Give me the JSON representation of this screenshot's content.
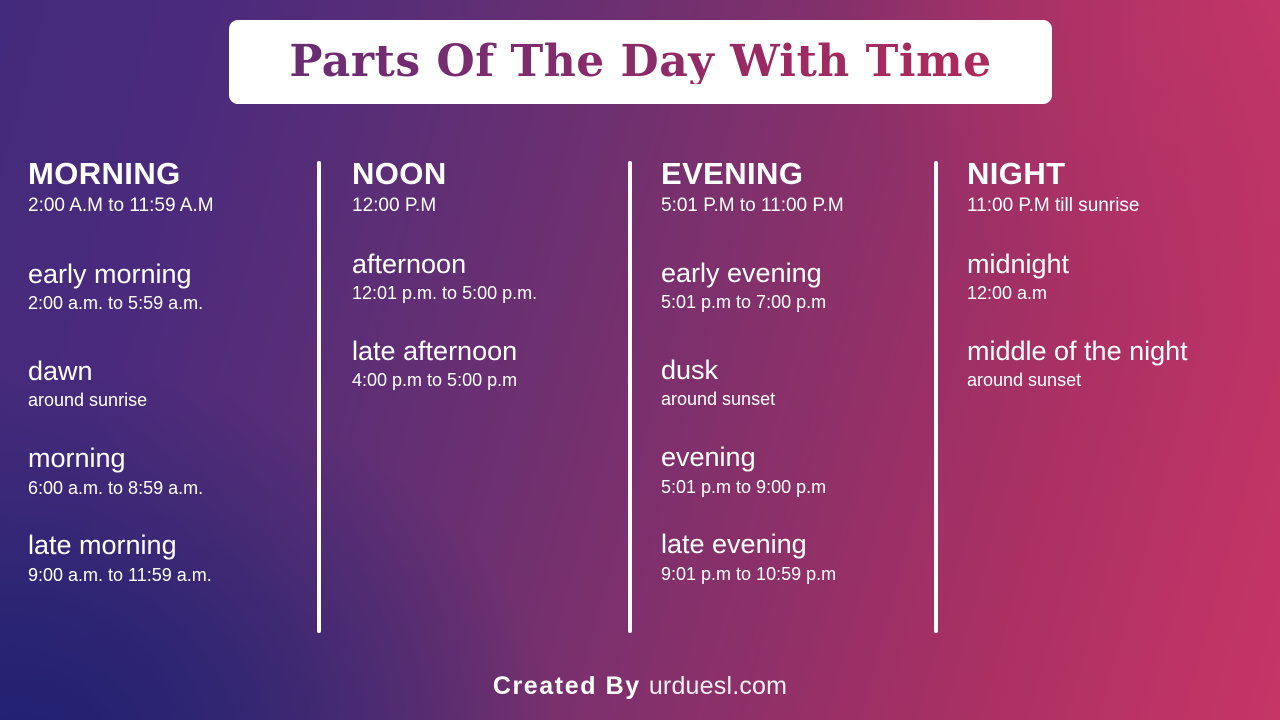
{
  "title": "Parts Of The Day With Time",
  "theme": {
    "bg_top_left": "#442a7c",
    "bg_top_right": "#c63566",
    "bg_bottom_left": "#252772",
    "bg_bottom_right": "#a93064",
    "bg_center": "#72306f",
    "title_gradient_start": "#6a2c74",
    "title_gradient_end": "#ae2a5d",
    "plate": "#ffffff",
    "text": "#ffffff",
    "divider": "#fdfdfe"
  },
  "columns": [
    {
      "heading": "MORNING",
      "heading_time": "2:00 A.M to 11:59 A.M",
      "entries": [
        {
          "name": "early morning",
          "time": "2:00 a.m. to 5:59 a.m."
        },
        {
          "name": "dawn",
          "time": "around sunrise"
        },
        {
          "name": "morning",
          "time": "6:00 a.m. to 8:59 a.m."
        },
        {
          "name": "late morning",
          "time": "9:00 a.m. to 11:59 a.m."
        }
      ]
    },
    {
      "heading": "NOON",
      "heading_time": "12:00 P.M",
      "entries": [
        {
          "name": "afternoon",
          "time": "12:01 p.m. to 5:00 p.m."
        },
        {
          "name": "late afternoon",
          "time": "4:00 p.m to 5:00 p.m"
        }
      ]
    },
    {
      "heading": "EVENING",
      "heading_time": "5:01 P.M to 11:00 P.M",
      "entries": [
        {
          "name": "early evening",
          "time": "5:01 p.m to 7:00 p.m"
        },
        {
          "name": "dusk",
          "time": "around sunset"
        },
        {
          "name": "evening",
          "time": "5:01 p.m to 9:00 p.m"
        },
        {
          "name": "late evening",
          "time": "9:01 p.m to 10:59 p.m"
        }
      ]
    },
    {
      "heading": "NIGHT",
      "heading_time": "11:00 P.M till sunrise",
      "entries": [
        {
          "name": "midnight",
          "time": "12:00 a.m"
        },
        {
          "name": "middle of the night",
          "time": "around sunset"
        }
      ]
    }
  ],
  "footer": {
    "created_label": "Created By",
    "site": "urduesl.com"
  }
}
